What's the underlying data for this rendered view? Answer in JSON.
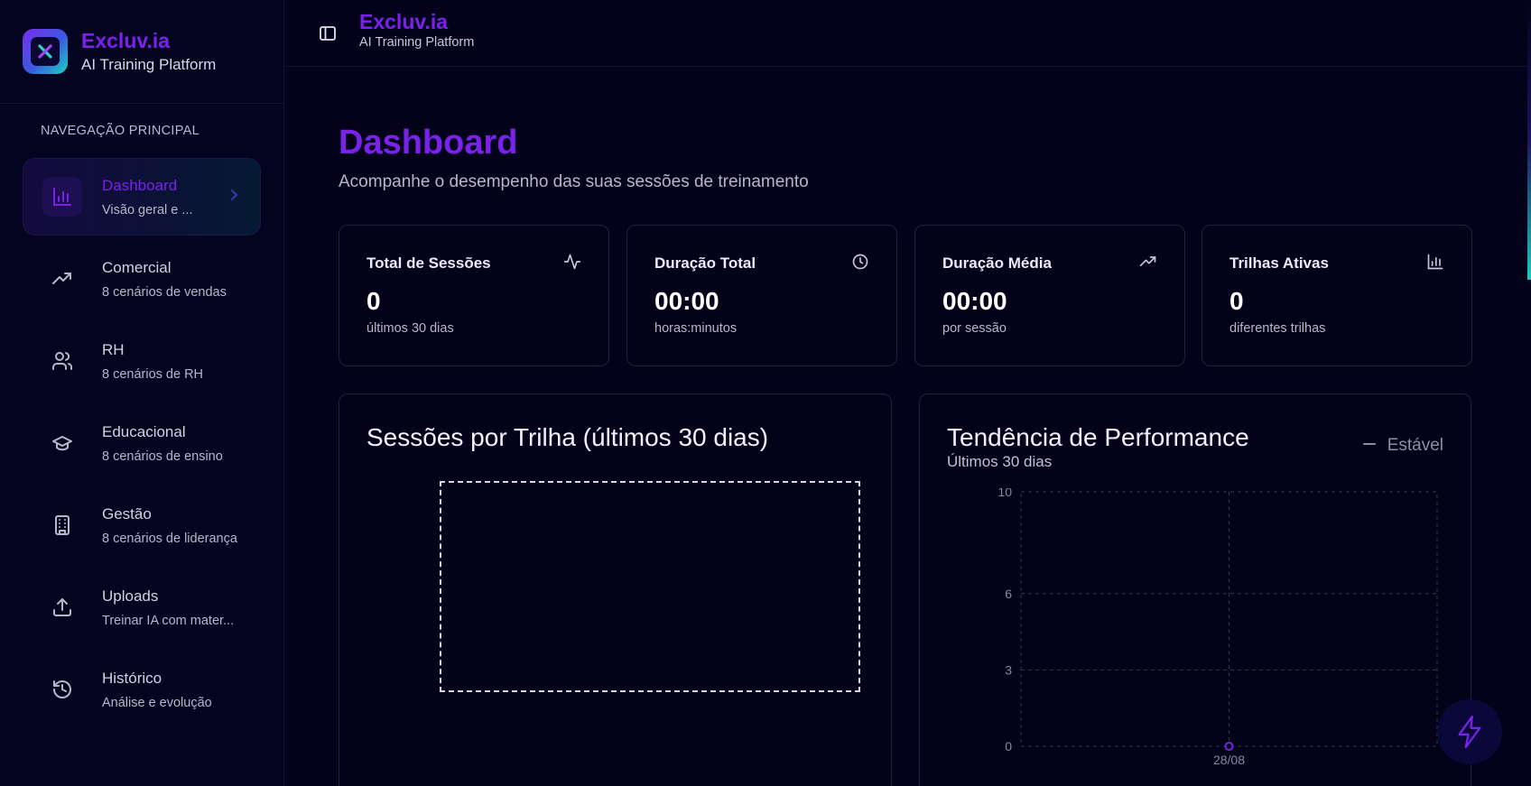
{
  "brand": {
    "name": "Excluv.ia",
    "subtitle": "AI Training Platform"
  },
  "topbar": {
    "name": "Excluv.ia",
    "subtitle": "AI Training Platform"
  },
  "sidebar": {
    "section_title": "NAVEGAÇÃO PRINCIPAL",
    "items": [
      {
        "label": "Dashboard",
        "desc": "Visão geral e ...",
        "icon": "bar-chart-icon",
        "active": true
      },
      {
        "label": "Comercial",
        "desc": "8 cenários de vendas",
        "icon": "trending-up-icon"
      },
      {
        "label": "RH",
        "desc": "8 cenários de RH",
        "icon": "users-icon"
      },
      {
        "label": "Educacional",
        "desc": "8 cenários de ensino",
        "icon": "graduation-cap-icon"
      },
      {
        "label": "Gestão",
        "desc": "8 cenários de liderança",
        "icon": "building-icon"
      },
      {
        "label": "Uploads",
        "desc": "Treinar IA com mater...",
        "icon": "upload-icon"
      },
      {
        "label": "Histórico",
        "desc": "Análise e evolução",
        "icon": "history-icon"
      }
    ]
  },
  "page": {
    "title": "Dashboard",
    "subtitle": "Acompanhe o desempenho das suas sessões de treinamento"
  },
  "stats": [
    {
      "label": "Total de Sessões",
      "value": "0",
      "note": "últimos 30 dias",
      "icon": "activity-icon"
    },
    {
      "label": "Duração Total",
      "value": "00:00",
      "note": "horas:minutos",
      "icon": "clock-icon"
    },
    {
      "label": "Duração Média",
      "value": "00:00",
      "note": "por sessão",
      "icon": "trending-up-icon"
    },
    {
      "label": "Trilhas Ativas",
      "value": "0",
      "note": "diferentes trilhas",
      "icon": "bar-chart-icon"
    }
  ],
  "sessions_panel": {
    "title": "Sessões por Trilha (últimos 30 dias)"
  },
  "performance_panel": {
    "title": "Tendência de Performance",
    "subtitle": "Últimos 30 dias",
    "trend_label": "Estável"
  },
  "chart_data": {
    "type": "line",
    "x": [
      "28/08"
    ],
    "series": [
      {
        "values": [
          0
        ]
      }
    ],
    "yticks": [
      0,
      3,
      6,
      10
    ],
    "ylim": [
      0,
      10
    ],
    "grid": true,
    "color": "#7a22ea"
  },
  "colors": {
    "accent": "#7a22ea",
    "background": "#03021a",
    "border": "#22213f"
  }
}
